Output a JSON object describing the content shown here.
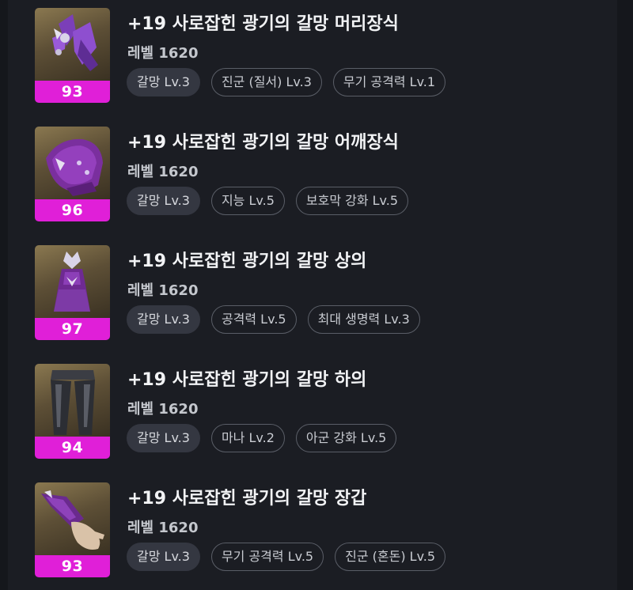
{
  "colors": {
    "background": "#15171c",
    "quality_badge": "#e01fd8",
    "title_text": "#f2f3f5",
    "filled_tag": "#343741",
    "outline_tag_border": "#5a5e67"
  },
  "items": [
    {
      "name": "+19 사로잡힌 광기의 갈망 머리장식",
      "level": "레벨 1620",
      "quality": "93",
      "icon": "purple-headpiece-icon",
      "tags": [
        "갈망 Lv.3",
        "진군 (질서) Lv.3",
        "무기 공격력 Lv.1"
      ]
    },
    {
      "name": "+19 사로잡힌 광기의 갈망 어깨장식",
      "level": "레벨 1620",
      "quality": "96",
      "icon": "purple-shoulder-icon",
      "tags": [
        "갈망 Lv.3",
        "지능 Lv.5",
        "보호막 강화 Lv.5"
      ]
    },
    {
      "name": "+19 사로잡힌 광기의 갈망 상의",
      "level": "레벨 1620",
      "quality": "97",
      "icon": "purple-top-icon",
      "tags": [
        "갈망 Lv.3",
        "공격력 Lv.5",
        "최대 생명력 Lv.3"
      ]
    },
    {
      "name": "+19 사로잡힌 광기의 갈망 하의",
      "level": "레벨 1620",
      "quality": "94",
      "icon": "dark-pants-icon",
      "tags": [
        "갈망 Lv.3",
        "마나 Lv.2",
        "아군 강화 Lv.5"
      ]
    },
    {
      "name": "+19 사로잡힌 광기의 갈망 장갑",
      "level": "레벨 1620",
      "quality": "93",
      "icon": "purple-glove-icon",
      "tags": [
        "갈망 Lv.3",
        "무기 공격력 Lv.5",
        "진군 (혼돈) Lv.5"
      ]
    }
  ]
}
